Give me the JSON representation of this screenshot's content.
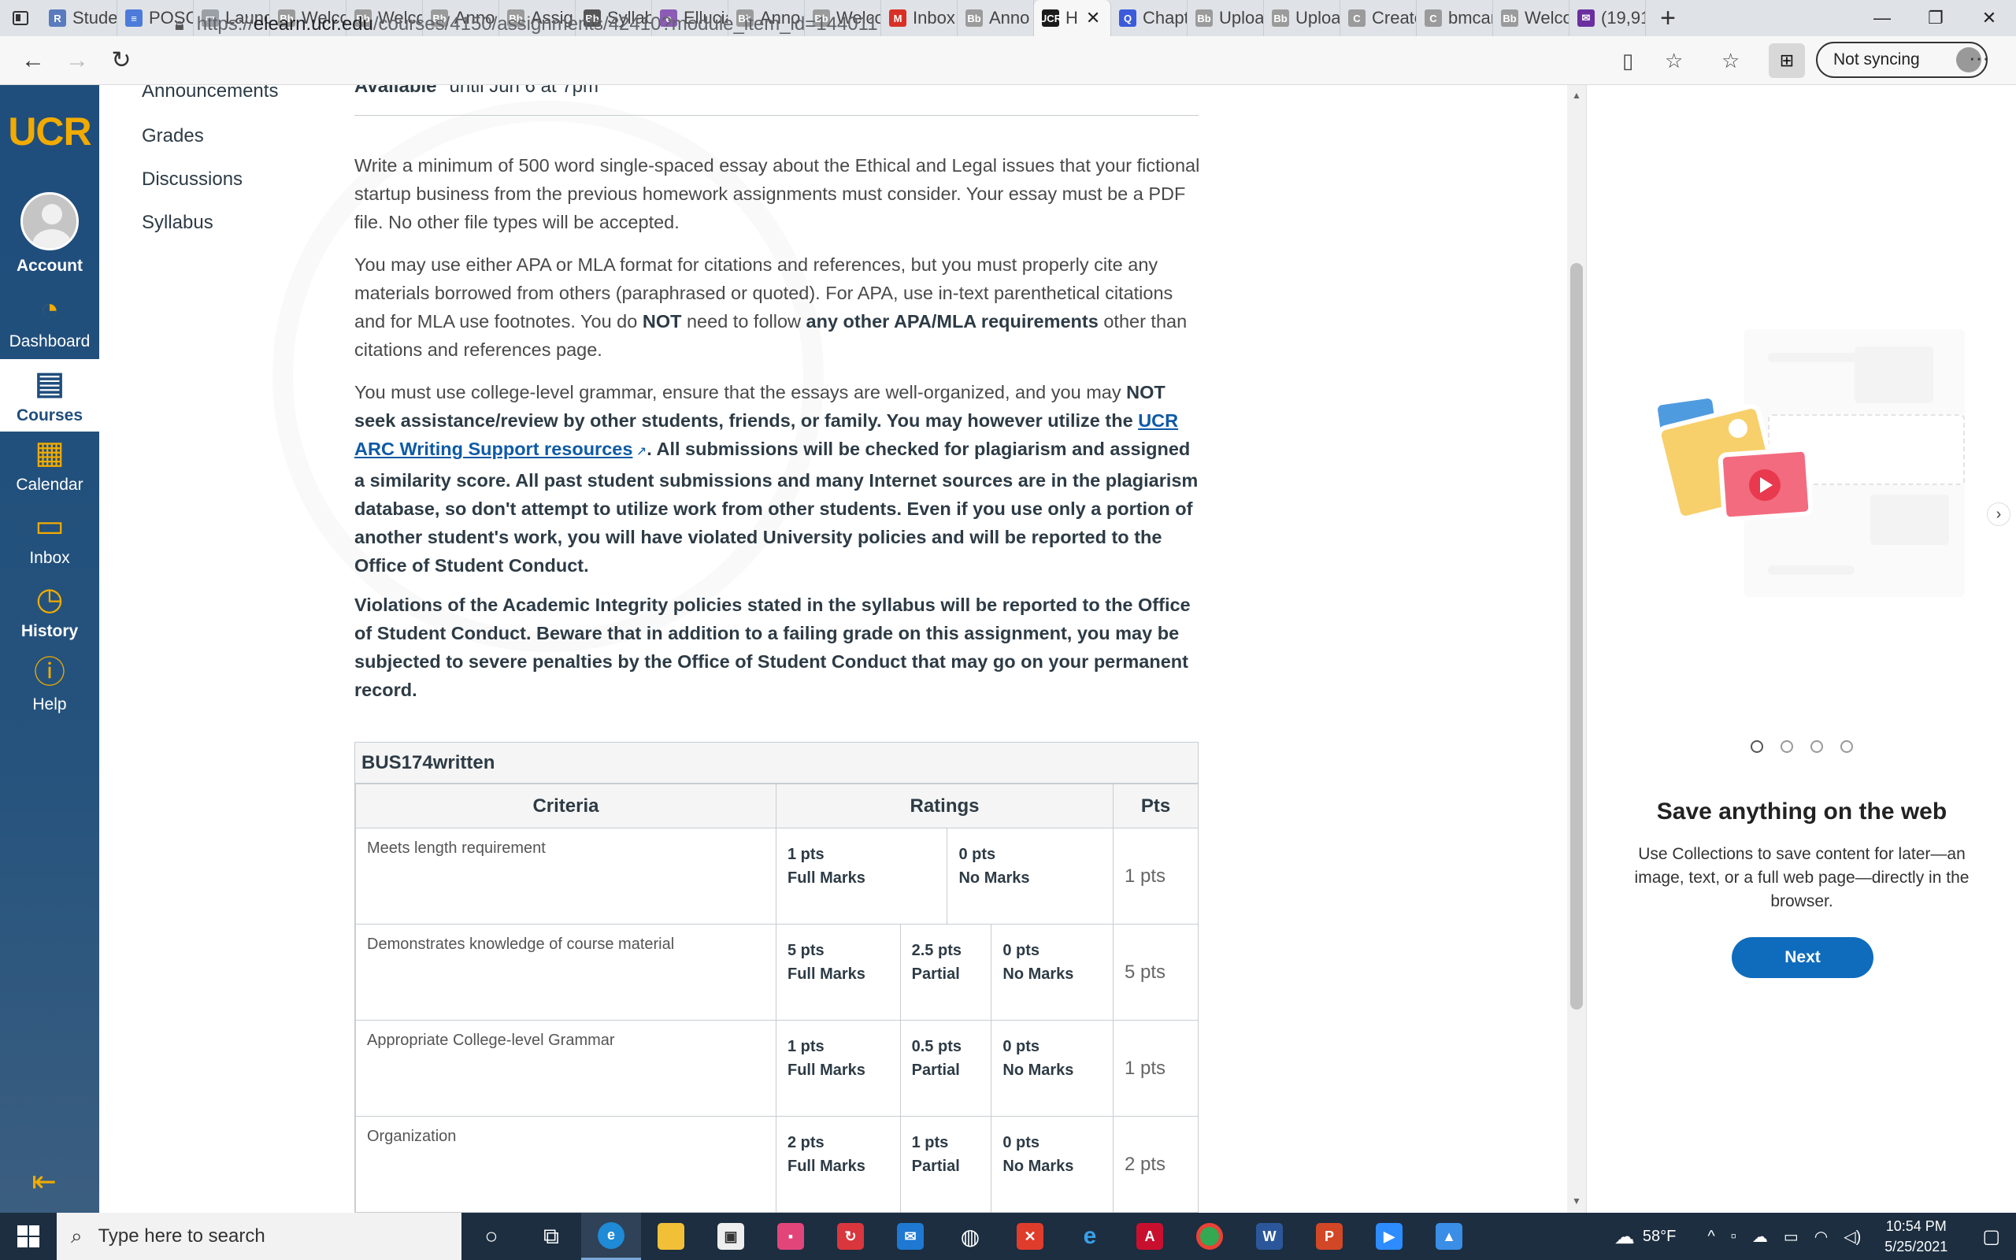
{
  "browser": {
    "tabs": [
      {
        "label": "Stude",
        "fav": "R",
        "color": "#5a7bbd"
      },
      {
        "label": "POSC",
        "fav": "≡",
        "color": "#4c7bd9"
      },
      {
        "label": "Launc",
        "fav": "▭",
        "color": "#9aa0a6"
      },
      {
        "label": "Welco",
        "fav": "Bb",
        "color": "#9b9b9b"
      },
      {
        "label": "Welco",
        "fav": "Bb",
        "color": "#9b9b9b"
      },
      {
        "label": "Anno",
        "fav": "Bb",
        "color": "#9b9b9b"
      },
      {
        "label": "Assig",
        "fav": "Bb",
        "color": "#9b9b9b"
      },
      {
        "label": "Syllab",
        "fav": "Bb",
        "color": "#555555"
      },
      {
        "label": "Ellucia",
        "fav": "e",
        "color": "#8c5bb5"
      },
      {
        "label": "Anno",
        "fav": "Bb",
        "color": "#9b9b9b"
      },
      {
        "label": "Welco",
        "fav": "Bb",
        "color": "#9b9b9b"
      },
      {
        "label": "Inbox",
        "fav": "M",
        "color": "#d93025"
      },
      {
        "label": "Anno",
        "fav": "Bb",
        "color": "#9b9b9b"
      },
      {
        "label": "H",
        "fav": "UCR",
        "color": "#1a1a1a",
        "active": true
      },
      {
        "label": "Chapt",
        "fav": "Q",
        "color": "#3b5bdb"
      },
      {
        "label": "Uploa",
        "fav": "Bb",
        "color": "#9b9b9b"
      },
      {
        "label": "Uploa",
        "fav": "Bb",
        "color": "#9b9b9b"
      },
      {
        "label": "Create",
        "fav": "C",
        "color": "#9b9b9b"
      },
      {
        "label": "bmcar",
        "fav": "C",
        "color": "#9b9b9b"
      },
      {
        "label": "Welco",
        "fav": "Bb",
        "color": "#9b9b9b"
      },
      {
        "label": "(19,91",
        "fav": "✉",
        "color": "#6b2fa0"
      }
    ],
    "url_prefix": "https://",
    "url_host": "elearn.ucr.edu",
    "url_path": "/courses/4150/assignments/42410?module_item_id=144011",
    "sync_label": "Not syncing"
  },
  "global_nav": {
    "logo": "UCR",
    "items": [
      {
        "label": "Account",
        "icon": "avatar"
      },
      {
        "label": "Dashboard",
        "icon": "dashboard-icon"
      },
      {
        "label": "Courses",
        "icon": "courses-icon",
        "current": true
      },
      {
        "label": "Calendar",
        "icon": "calendar-icon"
      },
      {
        "label": "Inbox",
        "icon": "inbox-icon"
      },
      {
        "label": "History",
        "icon": "history-icon"
      },
      {
        "label": "Help",
        "icon": "help-icon"
      }
    ]
  },
  "course_nav": {
    "links": [
      "Announcements",
      "Grades",
      "Discussions",
      "Syllabus"
    ]
  },
  "assignment": {
    "availability_label": "Available",
    "availability_value": "until Jun 6 at 7pm",
    "p1": "Write a minimum of 500 word single-spaced essay about the Ethical and Legal issues that your fictional startup business from the previous homework assignments must consider.  Your essay must be a PDF file.  No other file types will be accepted.",
    "p2_a": "You may use either APA or MLA format for citations and references, but you must properly cite any materials borrowed from others (paraphrased or quoted).  For APA, use in-text parenthetical citations and for MLA use footnotes.  You do ",
    "p2_b": "NOT",
    "p2_c": " need to follow ",
    "p2_d": "any other APA/MLA requirements",
    "p2_e": " other than citations and references page.",
    "p3_a": "You must use college-level grammar, ensure that the essays are well-organized, and you may ",
    "p3_b": "NOT seek assistance/review by other students, friends, or family.  You may however utilize the ",
    "p3_link": "UCR ARC Writing Support resources",
    "p3_c": ".  All submissions will be checked for plagiarism and assigned a similarity score.  All past student submissions and many Internet sources are in the plagiarism database, so don't attempt to utilize work from other students.  Even if you use only a portion of another student's work, you will have violated University policies and will be reported to the Office of Student Conduct.",
    "p4": "Violations of the Academic Integrity policies stated in the syllabus will be reported to the Office of Student Conduct.  Beware that in addition to a failing grade on this assignment, you may be subjected to severe penalties by the Office of Student Conduct that may go on your permanent record."
  },
  "rubric": {
    "title": "BUS174written",
    "headers": {
      "criteria": "Criteria",
      "ratings": "Ratings",
      "pts": "Pts"
    },
    "rows": [
      {
        "criterion": "Meets length requirement",
        "ratings": [
          {
            "pts": "1 pts",
            "desc": "Full Marks"
          },
          {
            "pts": "0 pts",
            "desc": "No Marks"
          }
        ],
        "total": "1 pts"
      },
      {
        "criterion": "Demonstrates knowledge of course material",
        "ratings": [
          {
            "pts": "5 pts",
            "desc": "Full Marks"
          },
          {
            "pts": "2.5 pts",
            "desc": "Partial"
          },
          {
            "pts": "0 pts",
            "desc": "No Marks"
          }
        ],
        "total": "5 pts"
      },
      {
        "criterion": "Appropriate College-level Grammar",
        "ratings": [
          {
            "pts": "1 pts",
            "desc": "Full Marks"
          },
          {
            "pts": "0.5 pts",
            "desc": "Partial"
          },
          {
            "pts": "0 pts",
            "desc": "No Marks"
          }
        ],
        "total": "1 pts"
      },
      {
        "criterion": "Organization",
        "ratings": [
          {
            "pts": "2 pts",
            "desc": "Full Marks"
          },
          {
            "pts": "1 pts",
            "desc": "Partial"
          },
          {
            "pts": "0 pts",
            "desc": "No Marks"
          }
        ],
        "total": "2 pts"
      }
    ]
  },
  "collections": {
    "title": "Save anything on the web",
    "description": "Use Collections to save content for later—an image, text, or a full web page—directly in the browser.",
    "next_label": "Next",
    "page_count": 4,
    "current_page": 1
  },
  "taskbar": {
    "search_placeholder": "Type here to search",
    "weather": "58°F",
    "time": "10:54 PM",
    "date": "5/25/2021"
  }
}
